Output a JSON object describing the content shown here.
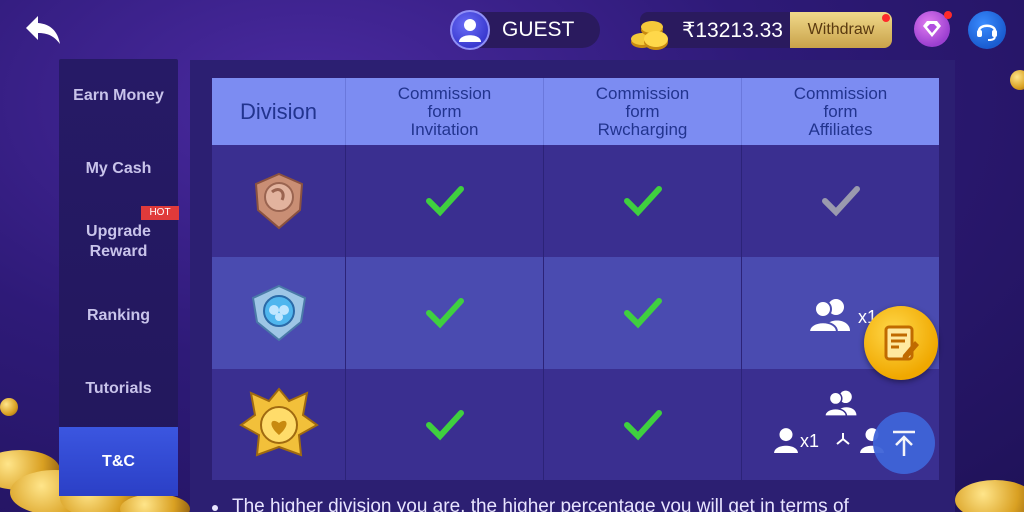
{
  "header": {
    "user_name": "GUEST",
    "balance": "₹13213.33",
    "withdraw_label": "Withdraw"
  },
  "sidebar": {
    "items": [
      {
        "label": "Earn Money"
      },
      {
        "label": "My Cash"
      },
      {
        "label": "Upgrade Reward"
      },
      {
        "label": "Ranking"
      },
      {
        "label": "Tutorials"
      },
      {
        "label": "T&C",
        "active": true
      }
    ],
    "hot_badge": "HOT"
  },
  "table": {
    "headers": {
      "division": "Division",
      "col1": [
        "Commission",
        "form",
        "Invitation"
      ],
      "col2": [
        "Commission",
        "form",
        "Rwcharging"
      ],
      "col3": [
        "Commission",
        "form",
        "Affiliates"
      ]
    },
    "rows": [
      {
        "division_icon": "bronze-badge-icon",
        "invitation": "check-icon",
        "recharging": "check-icon",
        "affiliates": "gray-check-icon"
      },
      {
        "division_icon": "silver-badge-icon",
        "invitation": "check-icon",
        "recharging": "check-icon",
        "affiliates_text": "x1"
      },
      {
        "division_icon": "gold-badge-icon",
        "invitation": "check-icon",
        "recharging": "check-icon",
        "affiliates_text": "x1"
      }
    ]
  },
  "footer": {
    "text": "The higher division you are, the higher percentage you will get in terms of"
  },
  "colors": {
    "accent": "#7c8cf2",
    "check": "#3fd03f",
    "gold": "#f0b400"
  }
}
